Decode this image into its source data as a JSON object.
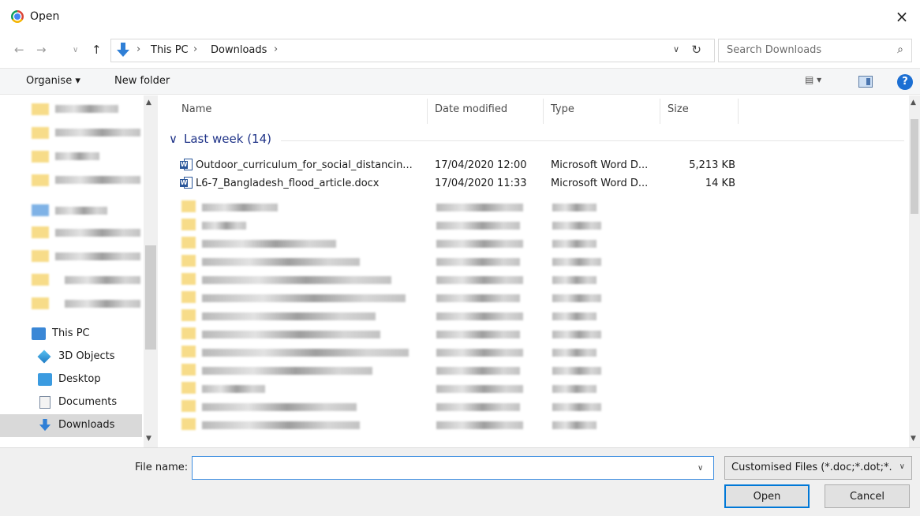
{
  "window": {
    "title": "Open",
    "close_symbol": "×"
  },
  "address": {
    "crumbs": [
      "This PC",
      "Downloads"
    ],
    "separator": "›",
    "search_placeholder": "Search Downloads"
  },
  "toolbar": {
    "organise_label": "Organise ▾",
    "new_folder_label": "New folder",
    "view_label": "▤ ▾",
    "help_label": "?"
  },
  "sidebar": {
    "items": [
      {
        "label": "This PC",
        "icon": "pc-icon"
      },
      {
        "label": "3D Objects",
        "icon": "cube-icon"
      },
      {
        "label": "Desktop",
        "icon": "desktop-icon"
      },
      {
        "label": "Documents",
        "icon": "documents-icon"
      },
      {
        "label": "Downloads",
        "icon": "download-icon",
        "selected": true
      }
    ]
  },
  "columns": {
    "name": "Name",
    "date": "Date modified",
    "type": "Type",
    "size": "Size"
  },
  "group": {
    "label": "Last week (14)",
    "toggle": "∨"
  },
  "files": [
    {
      "name": "Outdoor_curriculum_for_social_distancin...",
      "date": "17/04/2020 12:00",
      "type": "Microsoft Word D...",
      "size": "5,213 KB",
      "icon": "word-doc-icon"
    },
    {
      "name": "L6-7_Bangladesh_flood_article.docx",
      "date": "17/04/2020 11:33",
      "type": "Microsoft Word D...",
      "size": "14 KB",
      "icon": "word-doc-icon"
    }
  ],
  "bottom": {
    "filename_label": "File name:",
    "filename_value": "",
    "filetype_value": "Customised Files (*.doc;*.dot;*.",
    "open_label": "Open",
    "cancel_label": "Cancel"
  },
  "colors": {
    "accent": "#0078d7",
    "group_header": "#1e3287",
    "selected_bg": "#d9d9d9"
  }
}
